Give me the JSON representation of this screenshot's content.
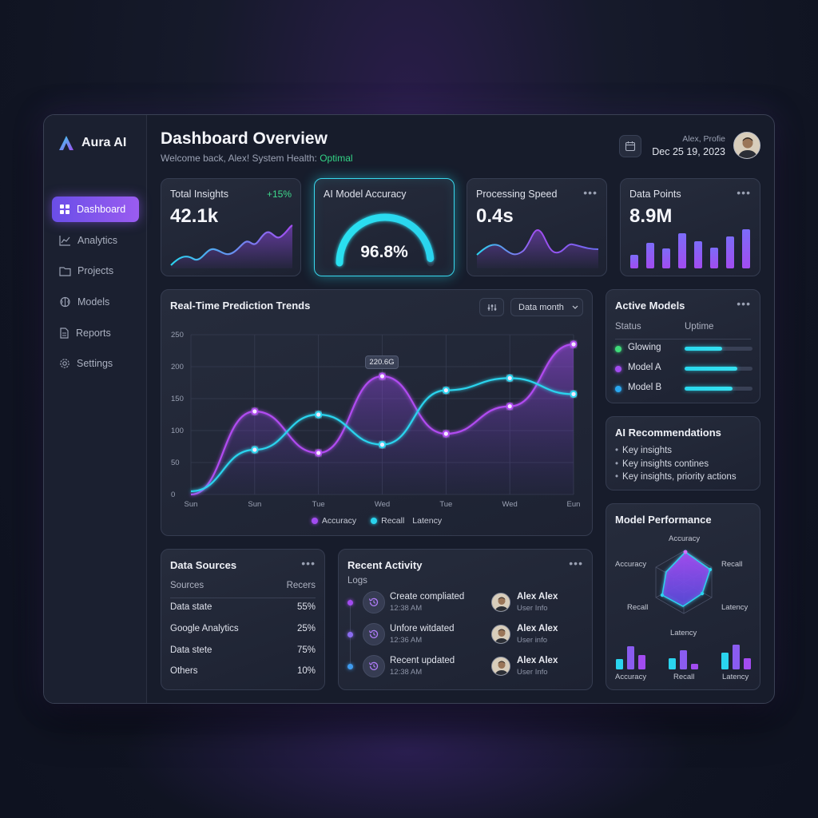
{
  "app": {
    "name": "Aura AI"
  },
  "sidebar": {
    "items": [
      {
        "label": "Dashboard",
        "icon": "grid-icon",
        "active": true
      },
      {
        "label": "Analytics",
        "icon": "line-chart-icon"
      },
      {
        "label": "Projects",
        "icon": "folder-icon"
      },
      {
        "label": "Models",
        "icon": "brain-icon"
      },
      {
        "label": "Reports",
        "icon": "document-icon"
      },
      {
        "label": "Settings",
        "icon": "gear-icon"
      }
    ]
  },
  "header": {
    "title": "Dashboard Overview",
    "subtitle": "Welcome back, Alex! System Health:",
    "health": "Optimal",
    "user_label": "Alex, Profie",
    "date": "Dec 25 19, 2023"
  },
  "kpis": {
    "total_insights": {
      "title": "Total Insights",
      "value": "42.1k",
      "delta": "+15%"
    },
    "accuracy": {
      "title": "AI Model Accuracy",
      "value": "96.8%",
      "percent": 96.8
    },
    "speed": {
      "title": "Processing Speed",
      "value": "0.4s"
    },
    "data_points": {
      "title": "Data Points",
      "value": "8.9M"
    }
  },
  "trend": {
    "title": "Real-Time Prediction Trends",
    "dropdown": "Data month",
    "tooltip": "220.6G",
    "legend": [
      "Accuracy",
      "Recall",
      "Latency"
    ]
  },
  "chart_data": {
    "type": "line",
    "categories": [
      "Sun",
      "Sun",
      "Tue",
      "Wed",
      "Tue",
      "Wed",
      "Eun"
    ],
    "yticks": [
      0,
      50,
      100,
      150,
      200,
      250
    ],
    "ylim": [
      0,
      250
    ],
    "series": [
      {
        "name": "Accuracy",
        "color": "#b04cf0",
        "values": [
          0,
          130,
          65,
          185,
          95,
          138,
          235
        ]
      },
      {
        "name": "Recall",
        "color": "#2ad4ee",
        "values": [
          5,
          70,
          125,
          78,
          163,
          182,
          157
        ]
      }
    ]
  },
  "active_models": {
    "title": "Active Models",
    "columns": [
      "Status",
      "Uptime"
    ],
    "rows": [
      {
        "name": "Glowing",
        "color": "#3fdc7a",
        "uptime": 0.55
      },
      {
        "name": "Model A",
        "color": "#a24cf0",
        "uptime": 0.78
      },
      {
        "name": "Model B",
        "color": "#2aa8f0",
        "uptime": 0.7
      }
    ]
  },
  "recommendations": {
    "title": "AI Recommendations",
    "items": [
      "Key insights",
      "Key insights contines",
      "Key insights, priority actions"
    ]
  },
  "data_sources": {
    "title": "Data Sources",
    "columns": [
      "Sources",
      "Recers"
    ],
    "rows": [
      {
        "name": "Data state",
        "value": "55%"
      },
      {
        "name": "Google Analytics",
        "value": "25%"
      },
      {
        "name": "Data stete",
        "value": "75%"
      },
      {
        "name": "Others",
        "value": "10%"
      }
    ]
  },
  "activity": {
    "title": "Recent Activity",
    "logs_label": "Logs",
    "rows": [
      {
        "title": "Create compliated",
        "time": "12:38 AM",
        "user": "Alex Alex",
        "info": "User Info",
        "dot": "#a24cf0"
      },
      {
        "title": "Unfore witdated",
        "time": "12:36 AM",
        "user": "Alex Alex",
        "info": "User info",
        "dot": "#8a6cf0"
      },
      {
        "title": "Recent updated",
        "time": "12:38 AM",
        "user": "Alex Alex",
        "info": "User Info",
        "dot": "#3f9cf0"
      }
    ]
  },
  "performance": {
    "title": "Model Performance",
    "radar_labels": {
      "top": "Accuracy",
      "left_top": "Accuracy",
      "right_top": "Recall",
      "left_bottom": "Recall",
      "right_bottom": "Latency",
      "bottom": "Latency"
    },
    "mini_labels": [
      "Accuracy",
      "Recall",
      "Latency"
    ]
  }
}
